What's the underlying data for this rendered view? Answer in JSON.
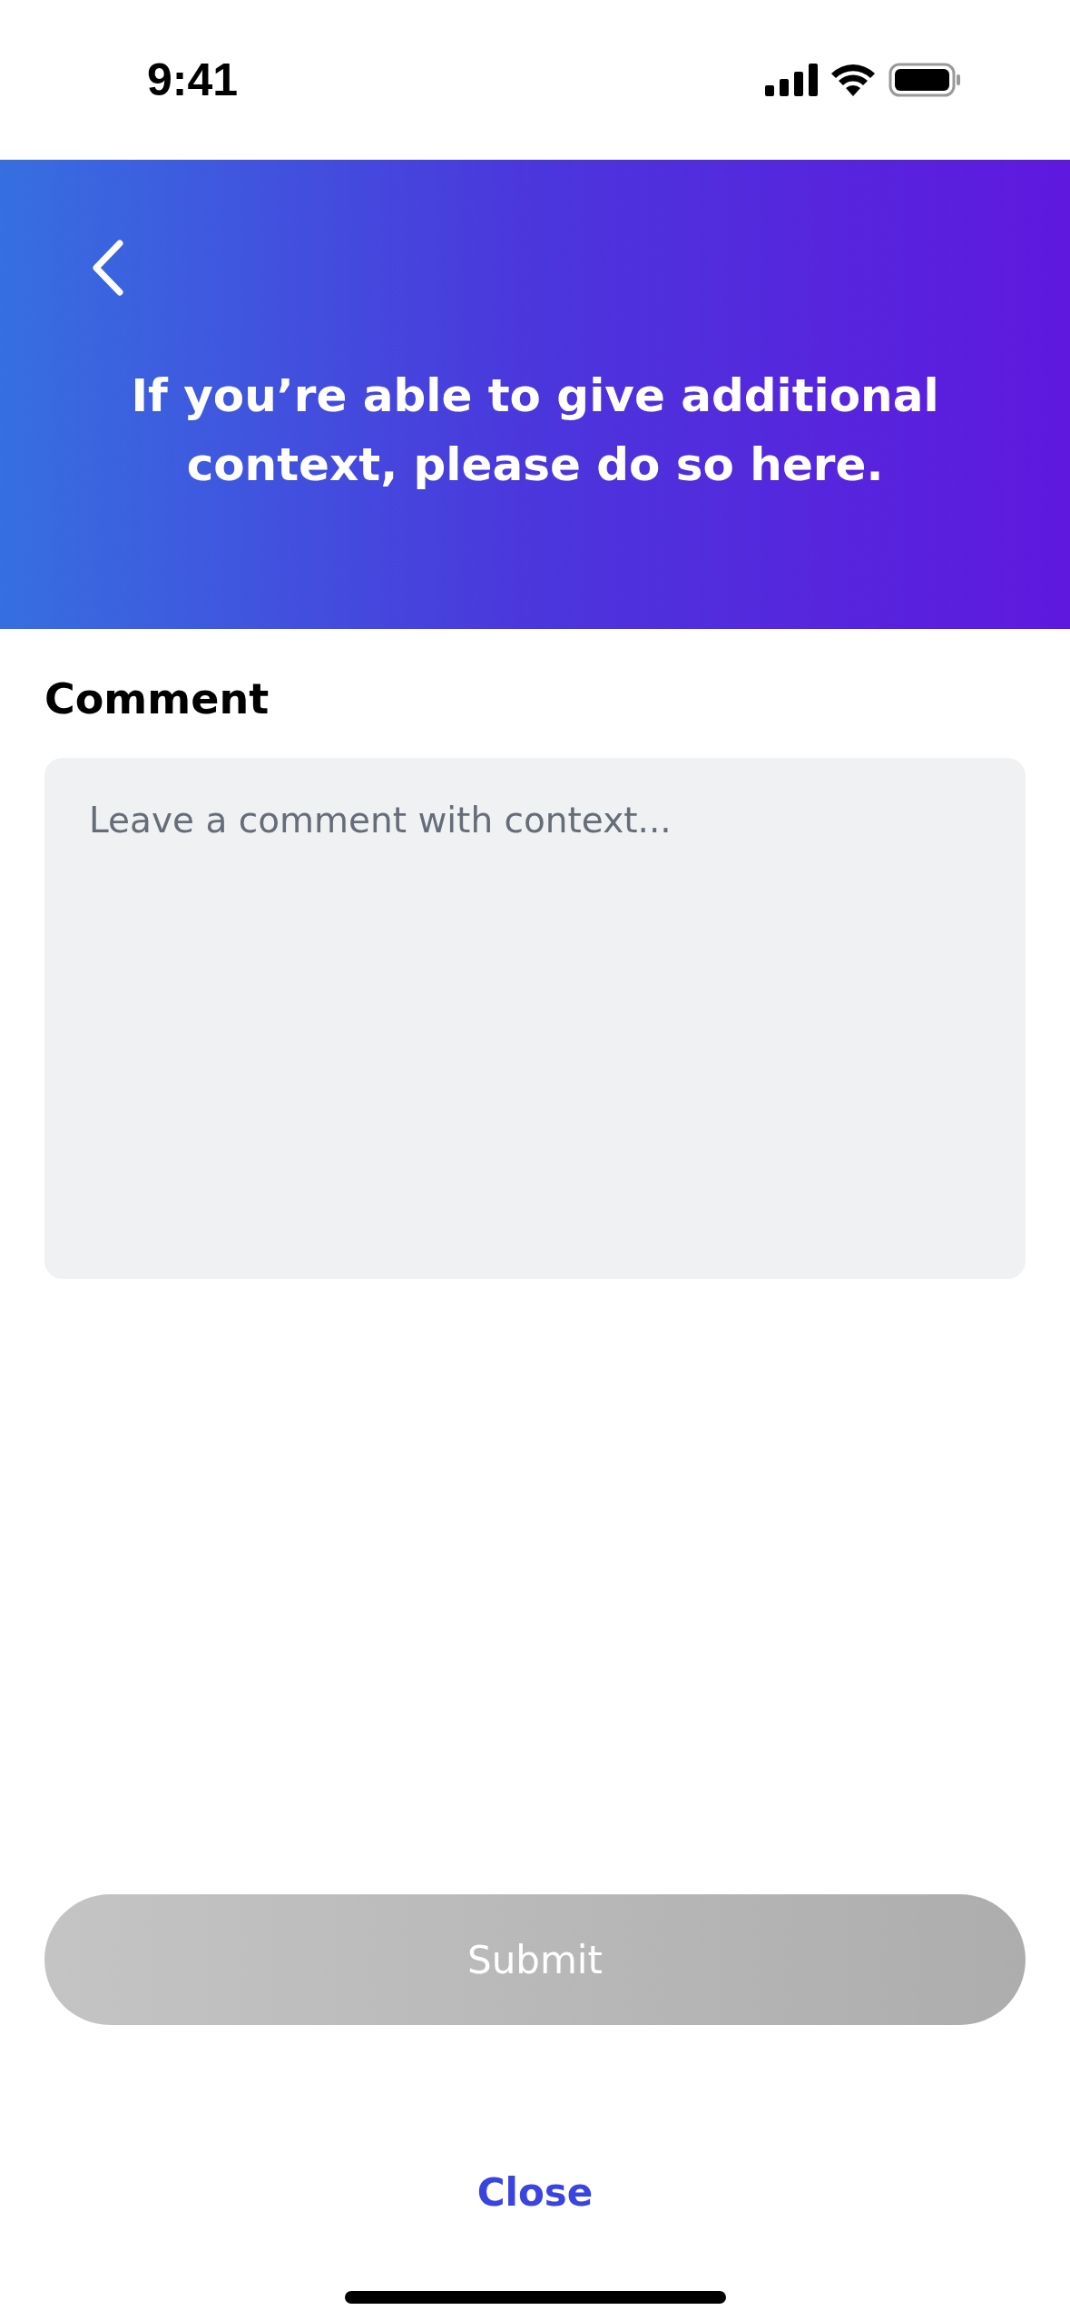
{
  "status_bar": {
    "time": "9:41"
  },
  "header": {
    "title": "If you’re able to give additional context, please do so here."
  },
  "comment": {
    "label": "Comment",
    "placeholder": "Leave a comment with context..."
  },
  "submit_button": {
    "label": "Submit",
    "disabled": true
  },
  "close_link": {
    "label": "Close"
  }
}
